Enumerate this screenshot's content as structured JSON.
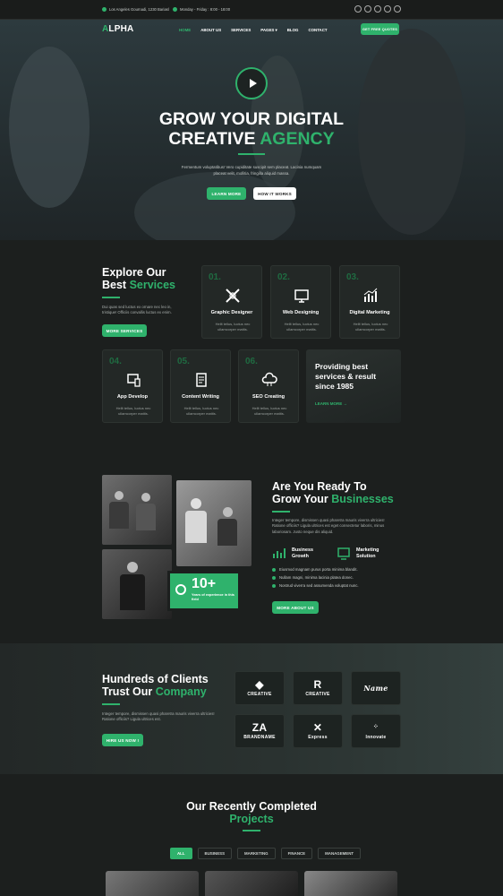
{
  "topbar": {
    "address": "Los Angeles Gournadi, 1230 Bariasl",
    "hours": "Monday - Friday : 8:00 - 18:00",
    "socials": [
      "facebook-icon",
      "twitter-icon",
      "instagram-icon",
      "linkedin-icon",
      "youtube-icon"
    ]
  },
  "header": {
    "logo_a": "A",
    "logo_rest": "LPHA",
    "nav": [
      "HOME",
      "ABOUT US",
      "SERVICES",
      "PAGES",
      "BLOG",
      "CONTACT"
    ],
    "cta": "GET FREE QUOTES"
  },
  "hero": {
    "title_line1": "GROW YOUR DIGITAL",
    "title_line2_a": "CREATIVE",
    "title_line2_b": "AGENCY",
    "description": "Fermentum voluptatibus! Vero cupiditate suscipit sem placeat. Lacinia numquam placeat velit, mollitia, fringilla aliquid massa.",
    "btn_primary": "LEARN MORE",
    "btn_secondary": "HOW IT WORKS"
  },
  "services": {
    "heading_a": "Explore Our",
    "heading_b": "Best",
    "heading_c": "Services",
    "description": "Dui quas sed luctus ex ornare nec leo in, tristique! Officiis convallis luctus ex enim.",
    "button": "MORE SERVICES",
    "cards": [
      {
        "num": "01.",
        "title": "Graphic Designer",
        "desc": "Hellt tellus, luctus nec ullamcorper mattis.",
        "icon": "tools-icon"
      },
      {
        "num": "02.",
        "title": "Web Designing",
        "desc": "Hellt tellus, luctus nec ullamcorper mattis.",
        "icon": "monitor-icon"
      },
      {
        "num": "03.",
        "title": "Digital Marketing",
        "desc": "Hellt tellus, luctus nec ullamcorper mattis.",
        "icon": "chart-icon"
      },
      {
        "num": "04.",
        "title": "App Develop",
        "desc": "Hellt tellus, luctus nec ullamcorper mattis.",
        "icon": "devices-icon"
      },
      {
        "num": "05.",
        "title": "Content Writing",
        "desc": "Hellt tellus, luctus nec ullamcorper mattis.",
        "icon": "document-icon"
      },
      {
        "num": "06.",
        "title": "SEO Creating",
        "desc": "Hellt tellus, luctus nec ullamcorper mattis.",
        "icon": "cloud-icon"
      }
    ],
    "promo_title": "Providing best services & result since 1985",
    "promo_link": "LEARN MORE →"
  },
  "about": {
    "heading_a": "Are You Ready To",
    "heading_b": "Grow Your",
    "heading_c": "Businesses",
    "description": "Integer tempore, dismissen quasi pharetra mauris viverra ultricies! Ratione officiis? Ligula ultrices est eget consectetur laboris, minus laboriosam. Justo neque dis aliquid.",
    "experience_num": "10+",
    "experience_text": "Years of experience in this field",
    "features": [
      "Business Growth",
      "Marketing Solution"
    ],
    "checks": [
      "Eiusmod magnam purus porta minima blandit.",
      "Nullam magni, minima lacinia platea donec.",
      "Nostrud viverra sed assumenda voluptat nunc."
    ],
    "button": "MORE ABOUT US"
  },
  "clients": {
    "heading_a": "Hundreds of Clients",
    "heading_b": "Trust Our",
    "heading_c": "Company",
    "description": "Integer tempore, dismissen quasi pharetra mauris viverra ultricies! Ratione officiis? Ligula ultrices est.",
    "button": "HIRE US NOW !",
    "brands": [
      {
        "name": "CREATIVE",
        "mark": "◆"
      },
      {
        "name": "CREATIVE",
        "mark": "R"
      },
      {
        "name": "Name",
        "mark": ""
      },
      {
        "name": "BRANDNAME",
        "mark": "ZA"
      },
      {
        "name": "Express",
        "mark": "✕"
      },
      {
        "name": "Innovate",
        "mark": ""
      }
    ]
  },
  "projects": {
    "heading_a": "Our Recently Completed",
    "heading_b": "Projects",
    "filters": [
      "ALL",
      "BUSINESS",
      "MARKETING",
      "FINANCE",
      "MANAGEMENT"
    ]
  },
  "colors": {
    "accent": "#2fb26c",
    "background": "#1c1f1e",
    "card": "#232826"
  }
}
